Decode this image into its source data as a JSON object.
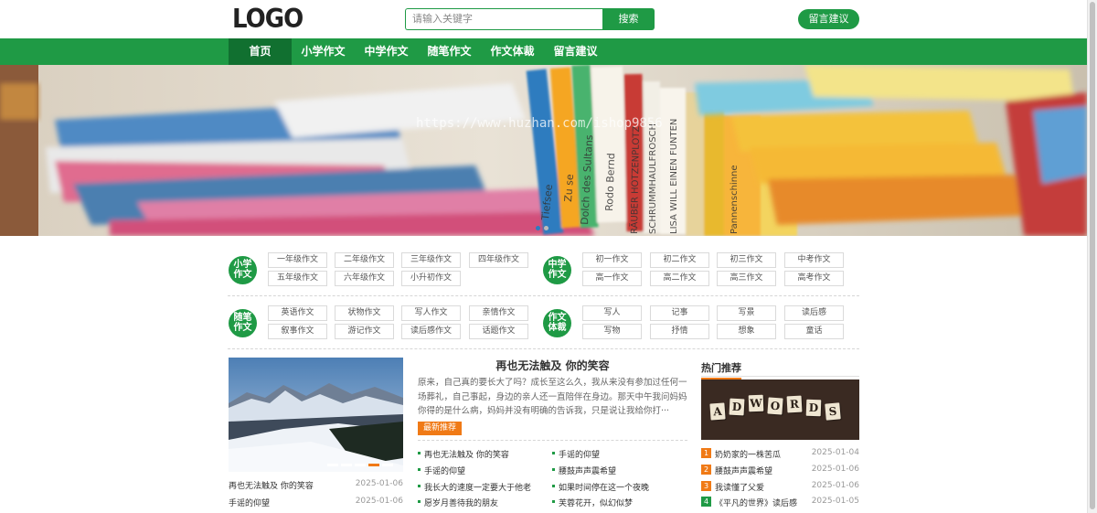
{
  "header": {
    "logo": "LOGO",
    "search_placeholder": "请输入关键字",
    "search_button": "搜索",
    "message_button": "留言建议"
  },
  "nav": {
    "items": [
      "首页",
      "小学作文",
      "中学作文",
      "随笔作文",
      "作文体裁",
      "留言建议"
    ],
    "active": 0
  },
  "banner": {
    "watermark": "https://www.huzhan.com/ishop9856",
    "book_spines": [
      "Zu se",
      "Tiefsee",
      "Dolch des Sultans",
      "Rodo Bernd",
      "RÄUBER HOTZENPLOTZ",
      "SCHRUMMHAULFROSCH",
      "LISA WILL EINEN FUNTEN",
      "Pannenschinne"
    ],
    "active_slide": 0,
    "slide_count": 2
  },
  "categories": {
    "primary": {
      "badge": "小学作文",
      "tags": [
        "一年级作文",
        "二年级作文",
        "三年级作文",
        "四年级作文",
        "五年级作文",
        "六年级作文",
        "小升初作文"
      ]
    },
    "middle": {
      "badge": "中学作文",
      "tags": [
        "初一作文",
        "初二作文",
        "初三作文",
        "中考作文",
        "高一作文",
        "高二作文",
        "高三作文",
        "高考作文"
      ]
    },
    "essay": {
      "badge": "随笔作文",
      "tags": [
        "英语作文",
        "状物作文",
        "写人作文",
        "亲情作文",
        "叙事作文",
        "游记作文",
        "读后感作文",
        "话题作文"
      ]
    },
    "genre": {
      "badge": "作文体裁",
      "tags": [
        "写人",
        "记事",
        "写景",
        "读后感",
        "写物",
        "抒情",
        "想象",
        "童话"
      ]
    }
  },
  "left_list": [
    {
      "title": "再也无法触及 你的笑容",
      "date": "2025-01-06"
    },
    {
      "title": "手谣的仰望",
      "date": "2025-01-06"
    }
  ],
  "article": {
    "title": "再也无法触及 你的笑容",
    "desc": "原来，自己真的要长大了吗？成长至这么久，我从来没有参加过任何一场葬礼，自己事起，身边的亲人还一直陪伴在身边。那天中午我问妈妈你得的是什么病，妈妈并没有明确的告诉我，只是说让我给你打···",
    "latest_label": "最新推荐"
  },
  "mid_list": {
    "col1": [
      "再也无法触及 你的笑容",
      "手谣的仰望",
      "我长大的速度一定要大于他老",
      "愿岁月善待我的朋友"
    ],
    "col2": [
      "手谣的仰望",
      "腰鼓声声震希望",
      "如果时间停在这一个夜晚",
      "芙蓉花开，似幻似梦"
    ]
  },
  "hot": {
    "title": "热门推荐",
    "image_letters": [
      "A",
      "D",
      "W",
      "O",
      "R",
      "D",
      "S"
    ],
    "items": [
      {
        "num": "1",
        "title": "奶奶家的一株苦瓜",
        "date": "2025-01-04",
        "color": "#f07a16"
      },
      {
        "num": "2",
        "title": "腰鼓声声震希望",
        "date": "2025-01-06",
        "color": "#f07a16"
      },
      {
        "num": "3",
        "title": "我读懂了父爱",
        "date": "2025-01-06",
        "color": "#f07a16"
      },
      {
        "num": "4",
        "title": "《平凡的世界》读后感",
        "date": "2025-01-05",
        "color": "#1f9a45"
      }
    ]
  },
  "colors": {
    "brand_green": "#1f9a45",
    "nav_active": "#117030",
    "accent_orange": "#f07a16"
  }
}
